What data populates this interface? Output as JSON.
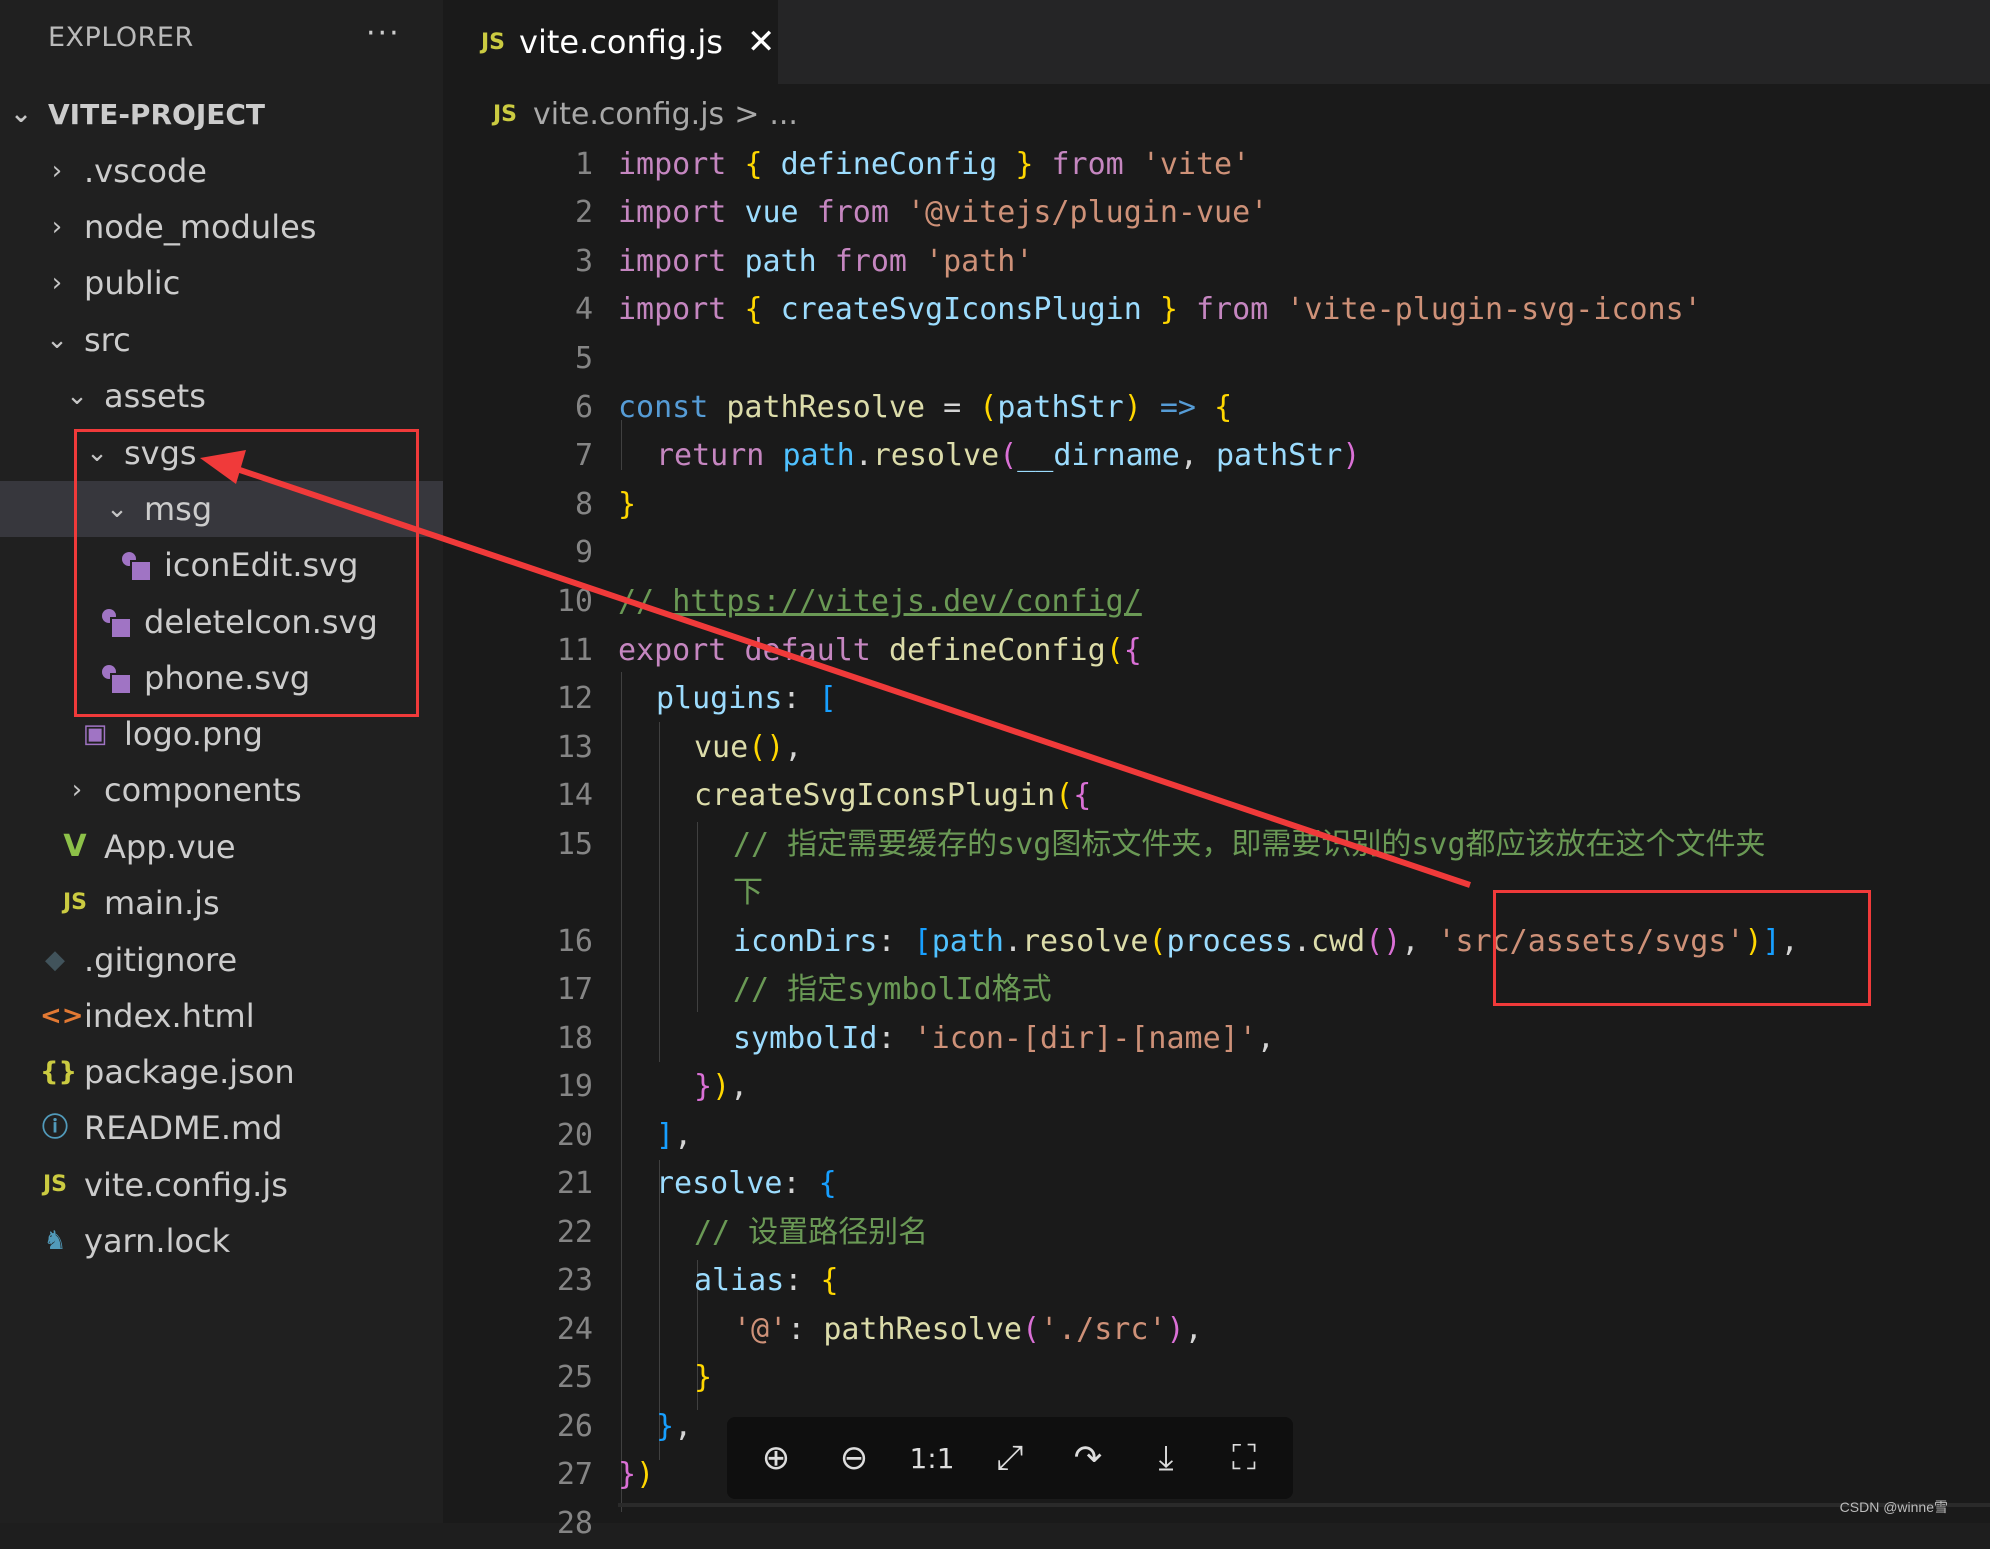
{
  "sidebar": {
    "header": "EXPLORER",
    "more": "···",
    "items": [
      {
        "label": "VITE-PROJECT",
        "type": "root",
        "chevron": "down"
      },
      {
        "label": ".vscode",
        "type": "folder",
        "chevron": "right"
      },
      {
        "label": "node_modules",
        "type": "folder",
        "chevron": "right"
      },
      {
        "label": "public",
        "type": "folder",
        "chevron": "right"
      },
      {
        "label": "src",
        "type": "folder",
        "chevron": "down"
      },
      {
        "label": "assets",
        "type": "folder",
        "chevron": "down"
      },
      {
        "label": "svgs",
        "type": "folder",
        "chevron": "down"
      },
      {
        "label": "msg",
        "type": "folder",
        "chevron": "down",
        "selected": true
      },
      {
        "label": "iconEdit.svg",
        "type": "svg-file-icon"
      },
      {
        "label": "deleteIcon.svg",
        "type": "svg-file-icon"
      },
      {
        "label": "phone.svg",
        "type": "svg-file-icon"
      },
      {
        "label": "logo.png",
        "type": "image-file-icon"
      },
      {
        "label": "components",
        "type": "folder",
        "chevron": "right"
      },
      {
        "label": "App.vue",
        "type": "vue-file-icon"
      },
      {
        "label": "main.js",
        "type": "js-file-icon"
      },
      {
        "label": ".gitignore",
        "type": "git-file-icon"
      },
      {
        "label": "index.html",
        "type": "html-file-icon"
      },
      {
        "label": "package.json",
        "type": "json-file-icon"
      },
      {
        "label": "README.md",
        "type": "info-file-icon"
      },
      {
        "label": "vite.config.js",
        "type": "js-file-icon"
      },
      {
        "label": "yarn.lock",
        "type": "yarn-file-icon"
      }
    ]
  },
  "icons": {
    "js": "JS",
    "chevron_right": "›",
    "chevron_down": "⌄",
    "png": "🖼",
    "vue": "V",
    "git": "◆",
    "html": "<>",
    "json": "{}",
    "info": "ⓘ",
    "yarn": "♞"
  },
  "editor": {
    "tab": {
      "title": "vite.config.js",
      "close": "✕"
    },
    "breadcrumb": {
      "file": "vite.config.js",
      "sep": ">",
      "rest": "..."
    },
    "lines": [
      "1",
      "2",
      "3",
      "4",
      "5",
      "6",
      "7",
      "8",
      "9",
      "10",
      "11",
      "12",
      "13",
      "14",
      "15",
      "",
      "16",
      "17",
      "18",
      "19",
      "20",
      "21",
      "22",
      "23",
      "24",
      "25",
      "26",
      "27",
      "28"
    ],
    "code": {
      "l1": {
        "a": "import",
        "b": "{",
        "c": "defineConfig",
        "d": "}",
        "e": "from",
        "f": "'vite'"
      },
      "l2": {
        "a": "import",
        "c": "vue",
        "e": "from",
        "f": "'@vitejs/plugin-vue'"
      },
      "l3": {
        "a": "import",
        "c": "path",
        "e": "from",
        "f": "'path'"
      },
      "l4": {
        "a": "import",
        "b": "{",
        "c": "createSvgIconsPlugin",
        "d": "}",
        "e": "from",
        "f": "'vite-plugin-svg-icons'"
      },
      "l6": {
        "a": "const",
        "c": "pathResolve",
        "eq": "=",
        "p1": "(",
        "arg": "pathStr",
        "p2": ")",
        "arrow": "=>",
        "br": "{"
      },
      "l7": {
        "a": "return",
        "obj": "path",
        "dot": ".",
        "fn": "resolve",
        "p1": "(",
        "v1": "__dirname",
        "comma": ",",
        "v2": "pathStr",
        "p2": ")"
      },
      "l8": {
        "br": "}"
      },
      "l10": {
        "slashes": "//",
        "url": "https://vitejs.dev/config/"
      },
      "l11": {
        "a": "export",
        "b": "default",
        "fn": "defineConfig",
        "p1": "(",
        "br": "{"
      },
      "l12": {
        "k": "plugins",
        "colon": ":",
        "br": "["
      },
      "l13": {
        "fn": "vue",
        "p": "()",
        "comma": ","
      },
      "l14": {
        "fn": "createSvgIconsPlugin",
        "p1": "(",
        "br": "{"
      },
      "l15": {
        "comment": "// 指定需要缓存的svg图标文件夹，即需要识别的svg都应该放在这个文件夹",
        "wrap": "下"
      },
      "l16": {
        "k": "iconDirs",
        "colon": ":",
        "br": "[",
        "obj": "path",
        "dot": ".",
        "fn": "resolve",
        "p1": "(",
        "obj2": "process",
        "dot2": ".",
        "fn2": "cwd",
        "pp": "()",
        "comma": ",",
        "str": "'src/assets/svgs'",
        "p2": ")",
        "br2": "]",
        "comma2": ","
      },
      "l17": {
        "comment": "// 指定symbolId格式"
      },
      "l18": {
        "k": "symbolId",
        "colon": ":",
        "str": "'icon-[dir]-[name]'",
        "comma": ","
      },
      "l19": {
        "br": "}",
        "p": ")",
        "comma": ","
      },
      "l20": {
        "br": "]",
        "comma": ","
      },
      "l21": {
        "k": "resolve",
        "colon": ":",
        "br": "{"
      },
      "l22": {
        "comment": "// 设置路径别名"
      },
      "l23": {
        "k": "alias",
        "colon": ":",
        "br": "{"
      },
      "l24": {
        "str": "'@'",
        "colon": ":",
        "fn": "pathResolve",
        "p1": "(",
        "str2": "'./src'",
        "p2": ")",
        "comma": ","
      },
      "l25": {
        "br": "}"
      },
      "l26": {
        "br": "}",
        "comma": ","
      },
      "l27": {
        "br": "}",
        "p": ")"
      }
    }
  },
  "toolbar": {
    "zoom_in": "⊕",
    "zoom_out": "⊖",
    "actual_size": "1:1",
    "expand": "⤢",
    "rotate": "↷",
    "download": "⤓",
    "fullscreen": "⛶"
  },
  "watermark": "CSDN @winne雪",
  "annotation_color": "#f03a3a"
}
